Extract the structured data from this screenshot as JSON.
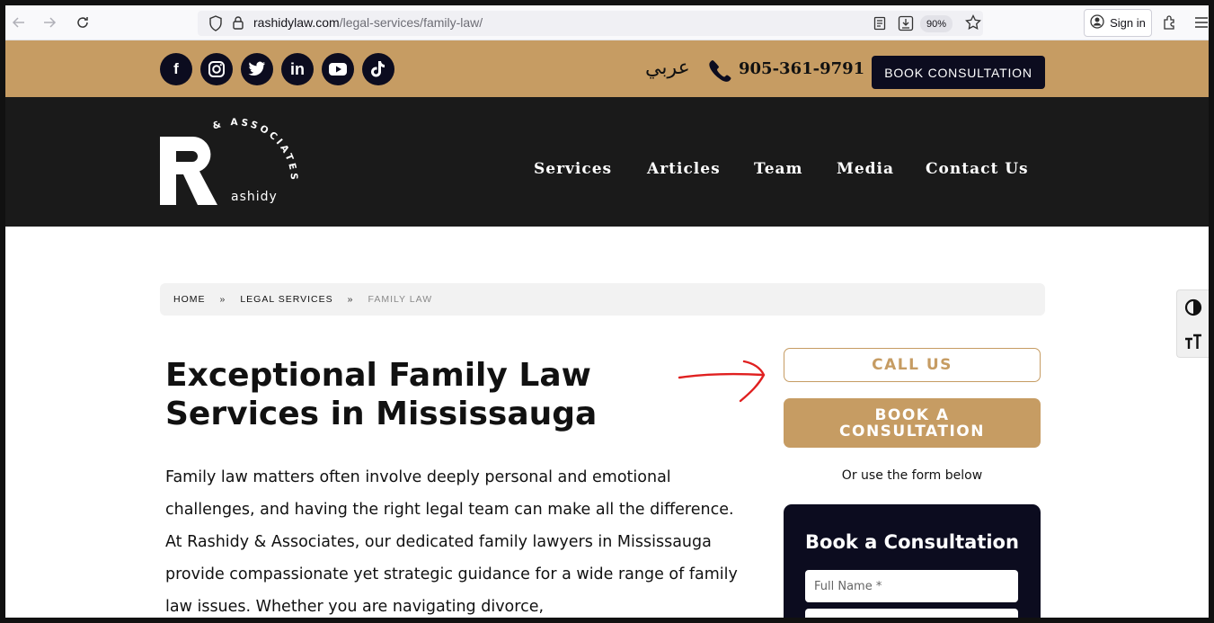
{
  "browser": {
    "url_host": "rashidylaw.com",
    "url_path": "/legal-services/family-law/",
    "zoom": "90%",
    "signin_label": "Sign in"
  },
  "topbar": {
    "socials": [
      {
        "name": "facebook",
        "glyph": "f"
      },
      {
        "name": "instagram",
        "glyph": "◎"
      },
      {
        "name": "twitter",
        "glyph": "🐦"
      },
      {
        "name": "linkedin",
        "glyph": "in"
      },
      {
        "name": "youtube",
        "glyph": "▶"
      },
      {
        "name": "tiktok",
        "glyph": "♪"
      }
    ],
    "arabic_label": "عربي",
    "phone": "905-361-9791",
    "book_label": "BOOK CONSULTATION"
  },
  "nav": {
    "logo_top_text": "& ASSOCIATES",
    "logo_side_text": "ashidy",
    "items": [
      "Services",
      "Articles",
      "Team",
      "Media",
      "Contact Us"
    ]
  },
  "breadcrumb": {
    "home": "HOME",
    "sep": "»",
    "legal": "LEGAL SERVICES",
    "current": "FAMILY LAW"
  },
  "main": {
    "heading_line1": "Exceptional Family Law",
    "heading_line2": "Services in Mississauga",
    "paragraph": "Family law matters often involve deeply personal and emotional challenges, and having the right legal team can make all the difference. At Rashidy & Associates, our dedicated family lawyers in Mississauga provide compassionate yet strategic guidance for a wide range of family law issues. Whether you are navigating divorce,"
  },
  "sidebar": {
    "call_us": "CALL US",
    "book_consultation": "BOOK A CONSULTATION",
    "or_use": "Or use the form below",
    "form_title": "Book a Consultation",
    "full_name_placeholder": "Full Name *"
  },
  "colors": {
    "gold": "#c69c63",
    "navy": "#0c0c1f",
    "dark": "#1a1a1a",
    "arrow": "#e02020"
  }
}
